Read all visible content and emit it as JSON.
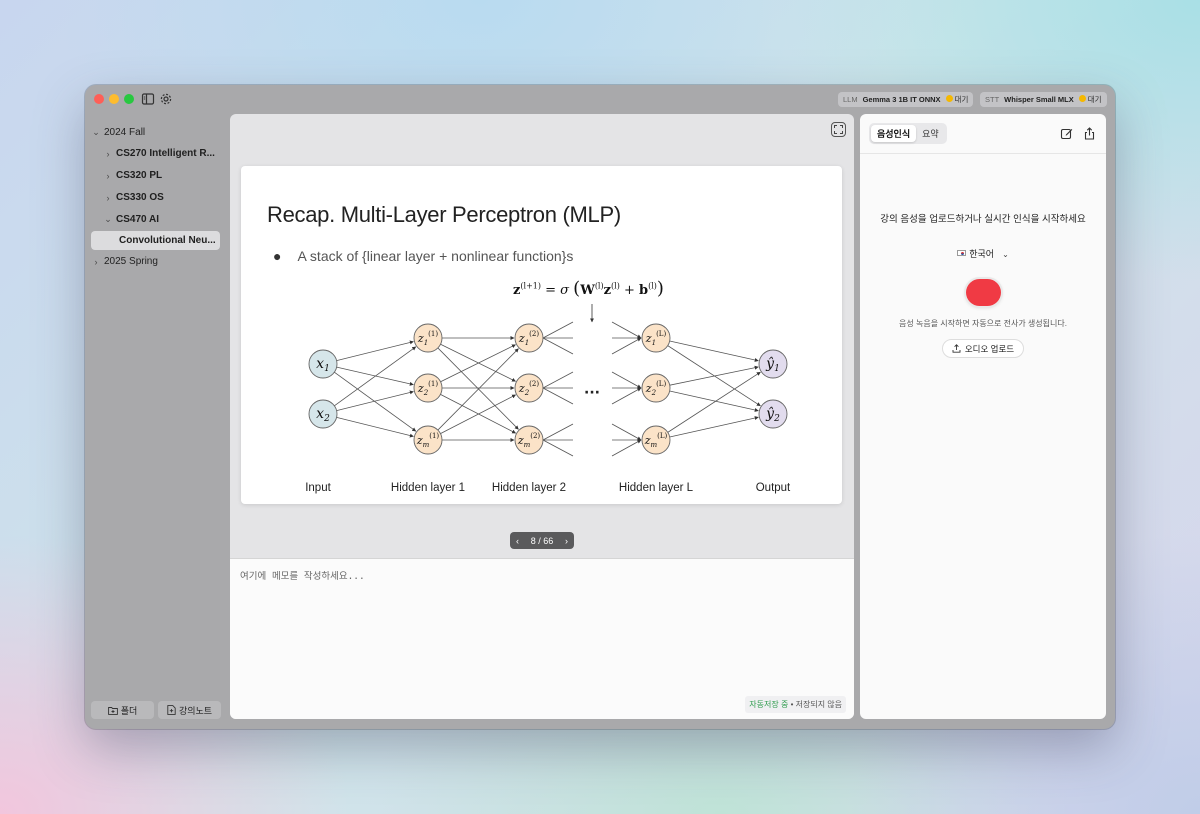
{
  "titlebar": {
    "llm": {
      "kind": "LLM",
      "name": "Gemma 3 1B IT ONNX",
      "status": "대기"
    },
    "stt": {
      "kind": "STT",
      "name": "Whisper Small MLX",
      "status": "대기"
    },
    "status_color": "#f5b800"
  },
  "sidebar": {
    "tree": [
      {
        "label": "2024 Fall",
        "expanded": true
      },
      {
        "label": "CS270 Intelligent R...",
        "expanded": false
      },
      {
        "label": "CS320 PL",
        "expanded": false
      },
      {
        "label": "CS330 OS",
        "expanded": false
      },
      {
        "label": "CS470 AI",
        "expanded": true
      },
      {
        "label": "Convolutional Neu...",
        "selected": true
      },
      {
        "label": "2025 Spring",
        "expanded": false
      }
    ],
    "folder_button": "폴더",
    "note_button": "강의노트"
  },
  "slide": {
    "title": "Recap. Multi-Layer Perceptron (MLP)",
    "bullet": "A stack of {linear layer + nonlinear function}s",
    "formula": "z(l+1) = σ(W(l) z(l) + b(l))",
    "layers": [
      "Input",
      "Hidden layer 1",
      "Hidden layer 2",
      "Hidden layer L",
      "Output"
    ],
    "ellipsis": "···"
  },
  "pager": {
    "current": 8,
    "total": 66,
    "text": "8 / 66"
  },
  "memo": {
    "placeholder": "여기에 메모를 작성하세요..."
  },
  "save_status": {
    "autosave": "자동저장 중",
    "separator": "•",
    "state": "저장되지 않음"
  },
  "right_panel": {
    "tabs": [
      "음성인식",
      "요약"
    ],
    "active_tab": "음성인식",
    "prompt": "강의 음성을 업로드하거나 실시간 인식을 시작하세요",
    "language": "한국어",
    "hint": "음성 녹음을 시작하면 자동으로 전사가 생성됩니다.",
    "upload_label": "오디오 업로드",
    "record_color": "#f03a44"
  }
}
